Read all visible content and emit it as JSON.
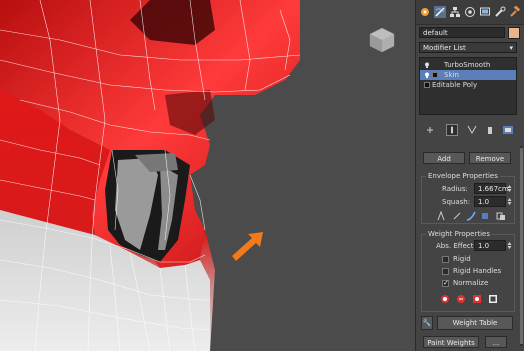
{
  "command_panel": {
    "object_name": "default",
    "modifier_list_label": "Modifier List",
    "colors": {
      "object_color": "#e9b48a",
      "selected_row": "#5b7fb8"
    }
  },
  "modifier_stack": [
    {
      "label": "TurboSmooth",
      "selected": false
    },
    {
      "label": "Skin",
      "selected": true
    },
    {
      "label": "Editable Poly",
      "selected": false
    }
  ],
  "buttons": {
    "add": "Add",
    "remove": "Remove",
    "weight_table": "Weight Table",
    "paint_weights": "Paint Weights",
    "more": "..."
  },
  "envelope": {
    "title": "Envelope Properties",
    "radius_label": "Radius:",
    "radius_value": "1.667cm",
    "squash_label": "Squash:",
    "squash_value": "1.0"
  },
  "weight": {
    "title": "Weight Properties",
    "abs_effect_label": "Abs. Effect:",
    "abs_effect_value": "1.0",
    "rigid": "Rigid",
    "rigid_handles": "Rigid Handles",
    "normalize": "Normalize",
    "normalize_checked": true
  },
  "viewport": {
    "icons": [
      "viewcube-icon",
      "arrow-icon"
    ]
  }
}
